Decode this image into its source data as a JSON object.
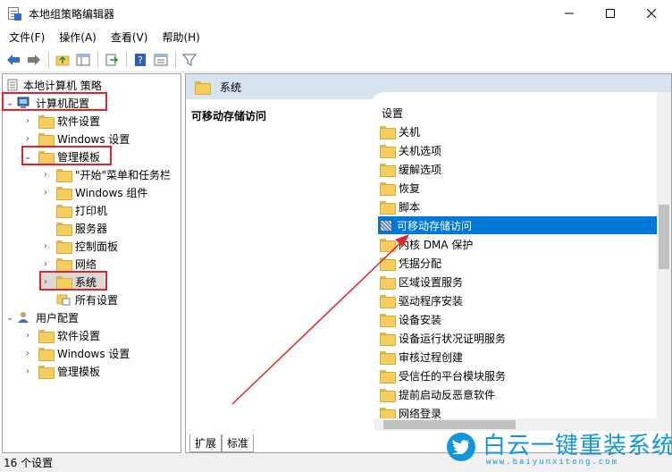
{
  "window": {
    "title": "本地组策略编辑器",
    "controls": {
      "minimize": "minimize-icon",
      "maximize": "maximize-icon",
      "close": "close-icon"
    }
  },
  "menu": [
    "文件(F)",
    "操作(A)",
    "查看(V)",
    "帮助(H)"
  ],
  "toolbar": [
    "back-arrow-icon",
    "forward-arrow-icon",
    "up-folder-icon",
    "show-hide-tree-icon",
    "export-list-icon",
    "help-icon",
    "properties-icon",
    "filter-icon"
  ],
  "tree": {
    "root": "本地计算机 策略",
    "computer_config": "计算机配置",
    "software_settings": "软件设置",
    "windows_settings": "Windows 设置",
    "admin_templates": "管理模板",
    "start_menu": "\"开始\"菜单和任务栏",
    "windows_components": "Windows 组件",
    "printers": "打印机",
    "server": "服务器",
    "control_panel": "控制面板",
    "network": "网络",
    "system": "系统",
    "all_settings": "所有设置",
    "user_config": "用户配置",
    "user_software_settings": "软件设置",
    "user_windows_settings": "Windows 设置",
    "user_admin_templates": "管理模板"
  },
  "right": {
    "header": "系统",
    "selected_title": "可移动存储访问",
    "settings_header": "设置",
    "settings": [
      {
        "label": "关机",
        "type": "folder"
      },
      {
        "label": "关机选项",
        "type": "folder"
      },
      {
        "label": "缓解选项",
        "type": "folder"
      },
      {
        "label": "恢复",
        "type": "folder"
      },
      {
        "label": "脚本",
        "type": "folder"
      },
      {
        "label": "可移动存储访问",
        "type": "policy",
        "selected": true
      },
      {
        "label": "内核 DMA 保护",
        "type": "folder"
      },
      {
        "label": "凭据分配",
        "type": "folder"
      },
      {
        "label": "区域设置服务",
        "type": "folder"
      },
      {
        "label": "驱动程序安装",
        "type": "folder"
      },
      {
        "label": "设备安装",
        "type": "folder"
      },
      {
        "label": "设备运行状况证明服务",
        "type": "folder"
      },
      {
        "label": "审核过程创建",
        "type": "folder"
      },
      {
        "label": "受信任的平台模块服务",
        "type": "folder"
      },
      {
        "label": "提前启动反恶意软件",
        "type": "folder"
      },
      {
        "label": "网络登录",
        "type": "folder"
      }
    ],
    "tabs": [
      "扩展",
      "标准"
    ]
  },
  "status": "16 个设置",
  "watermark": {
    "title": "白云一键重装系统",
    "url": "www.baiyunxitong.com"
  },
  "colors": {
    "selection": "#0078d7",
    "header_strip": "#d7e4f0",
    "highlight_box": "#e2232a",
    "folder": "#f5cd5e",
    "watermark": "#1296db"
  }
}
